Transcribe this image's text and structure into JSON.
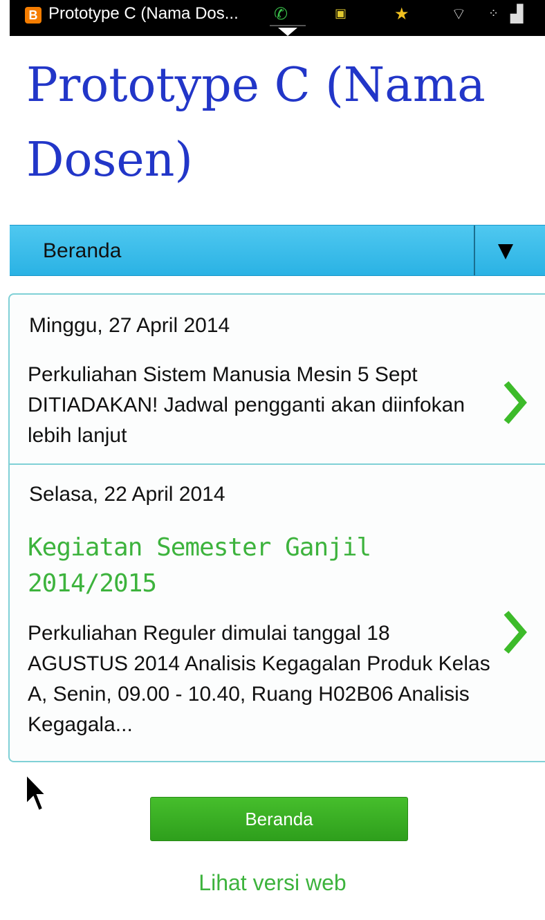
{
  "status_bar": {
    "app_icon": "blogger-icon",
    "app_icon_letter": "B",
    "window_title": "Prototype C (Nama Dos...",
    "icons": [
      "whatsapp-icon",
      "app-notification-icon",
      "star-icon",
      "wifi-icon",
      "bbm-icon",
      "signal-icon"
    ]
  },
  "page": {
    "title": "Prototype C (Nama Dosen)"
  },
  "nav": {
    "selected": "Beranda",
    "icon": "dropdown-arrow-icon",
    "bar_color": "#2ab2e4"
  },
  "posts": [
    {
      "date": "Minggu, 27 April 2014",
      "title": "",
      "snippet": "Perkuliahan Sistem Manusia Mesin 5 Sept DITIADAKAN! Jadwal pengganti akan diinfokan lebih lanjut"
    },
    {
      "date": "Selasa, 22 April 2014",
      "title": "Kegiatan Semester Ganjil 2014/2015",
      "snippet": "Perkuliahan Reguler dimulai tanggal 18 AGUSTUS 2014 Analisis Kegagalan Produk Kelas A, Senin, 09.00 - 10.40, Ruang H02B06 Analisis  Kegagala..."
    }
  ],
  "footer": {
    "home_button": "Beranda",
    "web_link": "Lihat versi web"
  },
  "colors": {
    "title": "#2236c8",
    "accent_green": "#3db33d",
    "button_green": "#2e9f1c"
  }
}
